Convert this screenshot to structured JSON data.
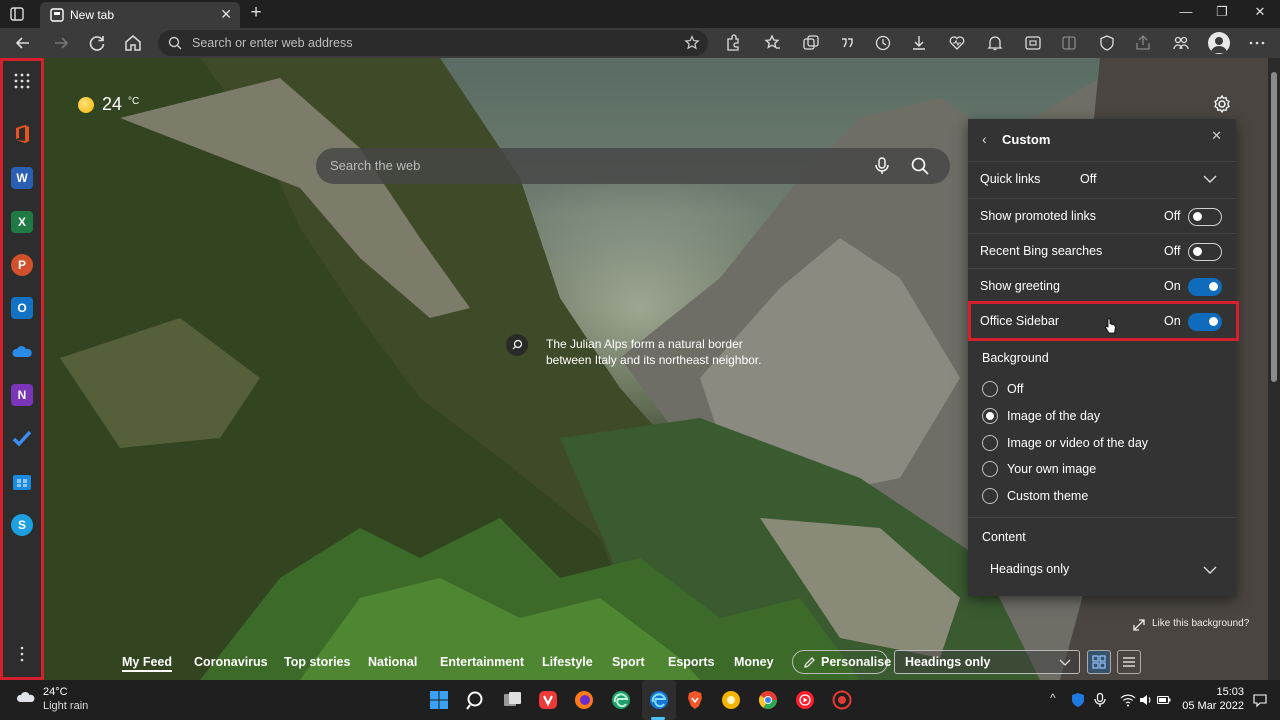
{
  "browser": {
    "tab_title": "New tab",
    "address_placeholder": "Search or enter web address"
  },
  "colors": {
    "accent": "#0f6cbd",
    "highlight": "#d3202c",
    "panel_bg": "#333333"
  },
  "sidebar": {
    "apps": [
      "apps-launcher",
      "office",
      "word",
      "excel",
      "powerpoint",
      "outlook",
      "onedrive",
      "onenote",
      "todo",
      "microsoft-store",
      "skype"
    ]
  },
  "weather": {
    "temp": "24",
    "unit": "°C"
  },
  "search": {
    "placeholder": "Search the web"
  },
  "background_caption": "The Julian Alps form a natural border between Italy and its northeast neighbor.",
  "panel": {
    "title": "Custom",
    "quick_links_label": "Quick links",
    "quick_links_value": "Off",
    "toggles": [
      {
        "label": "Show promoted links",
        "state": "Off",
        "on": false
      },
      {
        "label": "Recent Bing searches",
        "state": "Off",
        "on": false
      },
      {
        "label": "Show greeting",
        "state": "On",
        "on": true
      },
      {
        "label": "Office Sidebar",
        "state": "On",
        "on": true
      }
    ],
    "background_label": "Background",
    "background_options": [
      {
        "label": "Off",
        "selected": false
      },
      {
        "label": "Image of the day",
        "selected": true
      },
      {
        "label": "Image or video of the day",
        "selected": false
      },
      {
        "label": "Your own image",
        "selected": false
      },
      {
        "label": "Custom theme",
        "selected": false
      }
    ],
    "content_label": "Content",
    "content_value": "Headings only"
  },
  "like_background": "Like this background?",
  "feed": {
    "tabs": [
      "My Feed",
      "Coronavirus",
      "Top stories",
      "National",
      "Entertainment",
      "Lifestyle",
      "Sport",
      "Esports",
      "Money"
    ],
    "personalise": "Personalise",
    "headings": "Headings only"
  },
  "taskbar": {
    "temp": "24°C",
    "desc": "Light rain",
    "time": "15:03",
    "date": "05 Mar 2022"
  }
}
